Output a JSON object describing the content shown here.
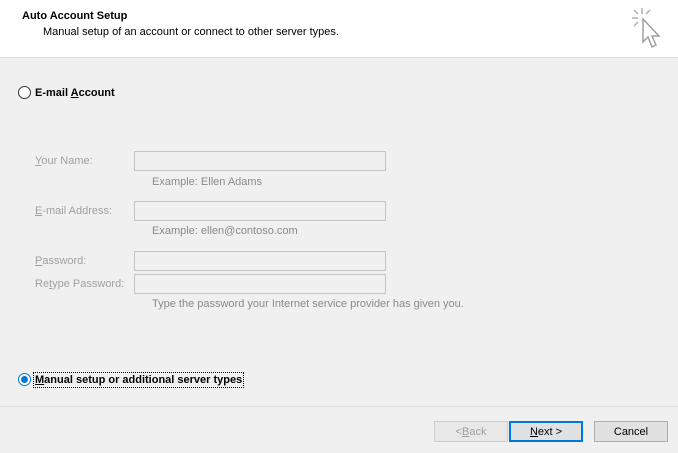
{
  "header": {
    "title": "Auto Account Setup",
    "subtitle": "Manual setup of an account or connect to other server types."
  },
  "email_account": {
    "label_prefix": "E-mail ",
    "label_accel": "A",
    "label_suffix": "ccount",
    "selected": false
  },
  "fields": {
    "name_accel": "Y",
    "name_rest": "our Name:",
    "name_hint": "Example: Ellen Adams",
    "email_accel": "E",
    "email_rest": "-mail Address:",
    "email_hint": "Example: ellen@contoso.com",
    "password_accel": "P",
    "password_rest": "assword:",
    "retype_prefix": "Re",
    "retype_accel": "t",
    "retype_rest": "ype Password:",
    "password_hint": "Type the password your Internet service provider has given you."
  },
  "manual_setup": {
    "label_accel": "M",
    "label_rest": "anual setup or additional server types",
    "selected": true
  },
  "buttons": {
    "back_prefix": "< ",
    "back_accel": "B",
    "back_rest": "ack",
    "next_accel": "N",
    "next_rest": "ext >",
    "cancel": "Cancel"
  },
  "icons": {
    "wizard": "cursor-sparkle-icon"
  }
}
